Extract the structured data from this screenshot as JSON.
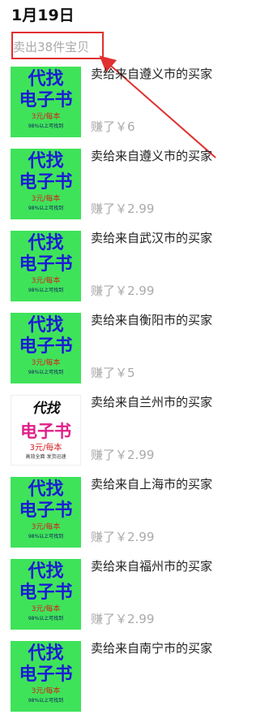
{
  "header": {
    "date": "1月19日",
    "sold_summary": "卖出38件宝贝"
  },
  "thumb_text": {
    "line1": "代找",
    "line2": "电子书",
    "price": "3元/每本",
    "note": "98%以上可找到",
    "alt_note": "高效全面   发货迅速"
  },
  "items": [
    {
      "title": "卖给来自遵义市的买家",
      "earned": "赚了￥6",
      "thumb_style": "green"
    },
    {
      "title": "卖给来自遵义市的买家",
      "earned": "赚了￥2.99",
      "thumb_style": "green"
    },
    {
      "title": "卖给来自武汉市的买家",
      "earned": "赚了￥2.99",
      "thumb_style": "green"
    },
    {
      "title": "卖给来自衡阳市的买家",
      "earned": "赚了￥5",
      "thumb_style": "green"
    },
    {
      "title": "卖给来自兰州市的买家",
      "earned": "赚了￥2.99",
      "thumb_style": "white"
    },
    {
      "title": "卖给来自上海市的买家",
      "earned": "赚了￥2.99",
      "thumb_style": "green"
    },
    {
      "title": "卖给来自福州市的买家",
      "earned": "赚了￥2.99",
      "thumb_style": "green"
    },
    {
      "title": "卖给来自南宁市的买家",
      "earned": "",
      "thumb_style": "green"
    }
  ],
  "colors": {
    "annotation_red": "#e03030",
    "thumb_green": "#3fe35a",
    "thumb_text_blue": "#1b1bd6"
  }
}
